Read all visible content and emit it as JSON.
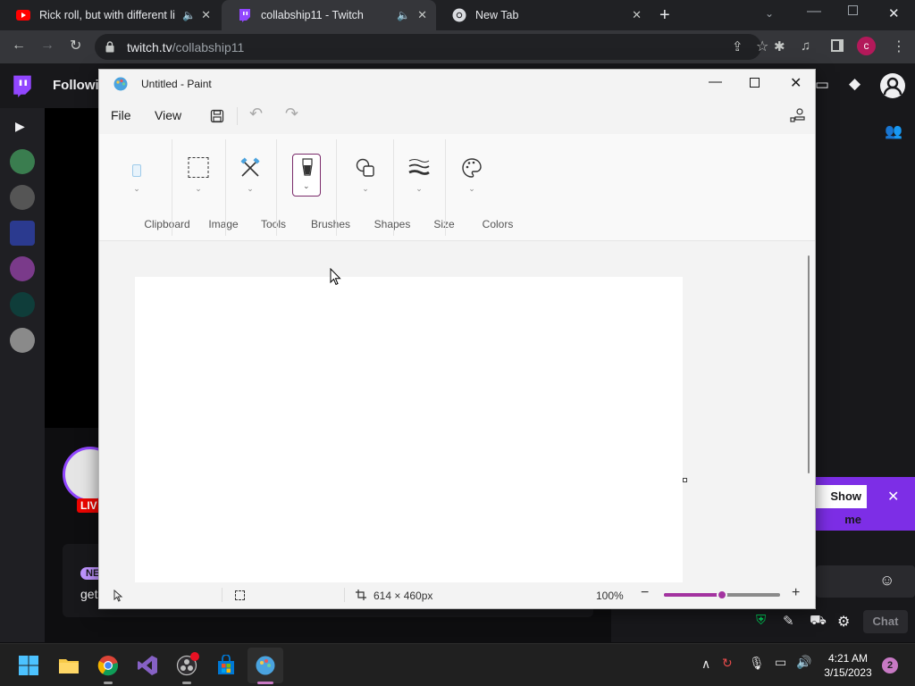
{
  "browser": {
    "tabs": [
      {
        "title": "Rick roll, but with different li",
        "icon": "youtube-icon"
      },
      {
        "title": "collabship11 - Twitch",
        "icon": "twitch-icon"
      },
      {
        "title": "New Tab",
        "icon": "chrome-icon"
      }
    ],
    "url_domain": "twitch.tv",
    "url_path": "/collabship11",
    "profile_initial": "c",
    "colors": {
      "chrome_dark": "#202124",
      "chrome_tab": "#35363a",
      "youtube": "#ff0000",
      "twitch": "#9146ff"
    }
  },
  "twitch": {
    "nav_following": "Followin",
    "live_badge": "LIV",
    "new_badge": "NE",
    "chat_snippet": "get",
    "popup_button": "Show me",
    "chat_button": "Chat"
  },
  "paint": {
    "title": "Untitled - Paint",
    "menu": {
      "file": "File",
      "view": "View"
    },
    "ribbon": {
      "clipboard": "Clipboard",
      "image": "Image",
      "tools": "Tools",
      "brushes": "Brushes",
      "shapes": "Shapes",
      "size": "Size",
      "colors": "Colors"
    },
    "status": {
      "canvas_size": "614 × 460px",
      "zoom": "100%",
      "zoom_level": 0.5
    }
  },
  "taskbar": {
    "time": "4:21 AM",
    "date": "3/15/2023",
    "notifications": "2"
  }
}
